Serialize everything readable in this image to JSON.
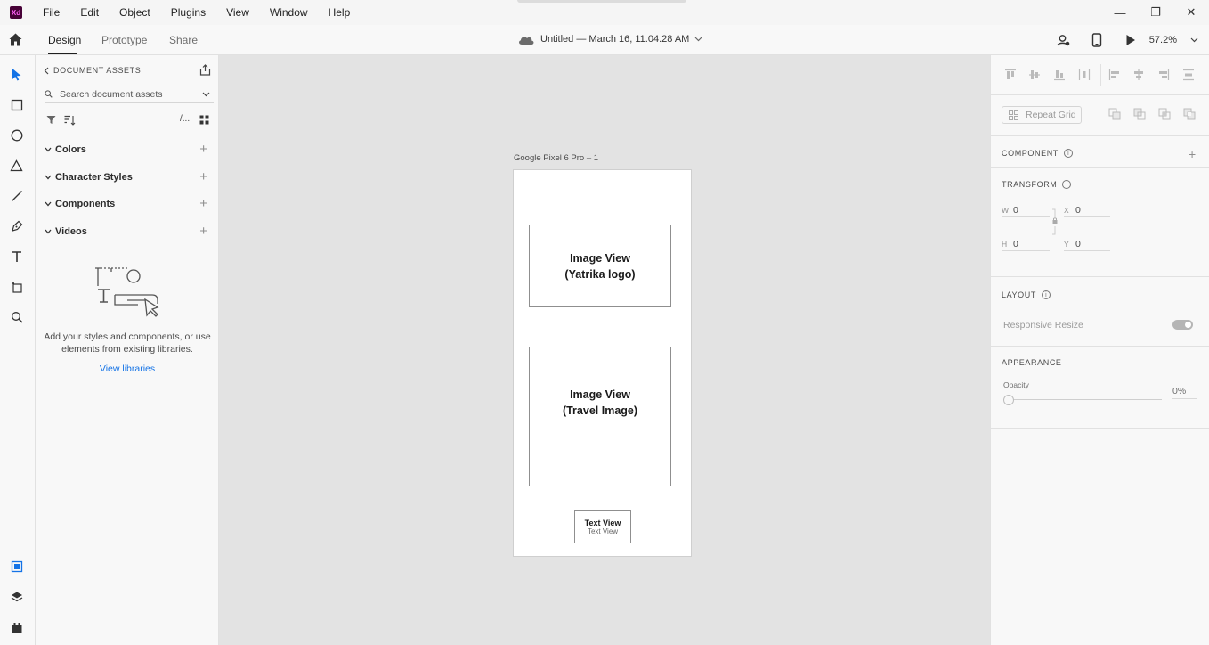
{
  "app": {
    "logo_text": "Xd"
  },
  "menu": [
    "File",
    "Edit",
    "Object",
    "Plugins",
    "View",
    "Window",
    "Help"
  ],
  "window_controls": {
    "minimize": "—",
    "restore": "❐",
    "close": "✕"
  },
  "toolbar": {
    "tabs": [
      {
        "label": "Design",
        "active": true
      },
      {
        "label": "Prototype",
        "active": false
      },
      {
        "label": "Share",
        "active": false
      }
    ],
    "document_title": "Untitled — March 16, 11.04.28 AM",
    "zoom": "57.2%"
  },
  "assets": {
    "header": "DOCUMENT ASSETS",
    "search_placeholder": "Search document assets",
    "sections": [
      "Colors",
      "Character Styles",
      "Components",
      "Videos"
    ],
    "empty_text": "Add your styles and components, or use elements from existing libraries.",
    "view_libraries": "View libraries",
    "filter_text": "/..."
  },
  "canvas": {
    "artboard_name": "Google Pixel 6 Pro – 1",
    "boxes": {
      "logo": "Image View\n(Yatrika logo)",
      "travel": "Image View\n(Travel Image)",
      "text_title": "Text View",
      "text_sub": "Text View"
    }
  },
  "properties": {
    "repeat_grid": "Repeat Grid",
    "component_label": "COMPONENT",
    "transform_label": "TRANSFORM",
    "fields": {
      "w_label": "W",
      "w": "0",
      "x_label": "X",
      "x": "0",
      "h_label": "H",
      "h": "0",
      "y_label": "Y",
      "y": "0"
    },
    "layout_label": "LAYOUT",
    "responsive_resize": "Responsive Resize",
    "responsive_resize_on": true,
    "appearance_label": "APPEARANCE",
    "opacity_label": "Opacity",
    "opacity_value": "0%"
  },
  "colors": {
    "accent": "#1473e6",
    "xd_brand": "#470137",
    "xd_brand_text": "#ff61f6"
  }
}
